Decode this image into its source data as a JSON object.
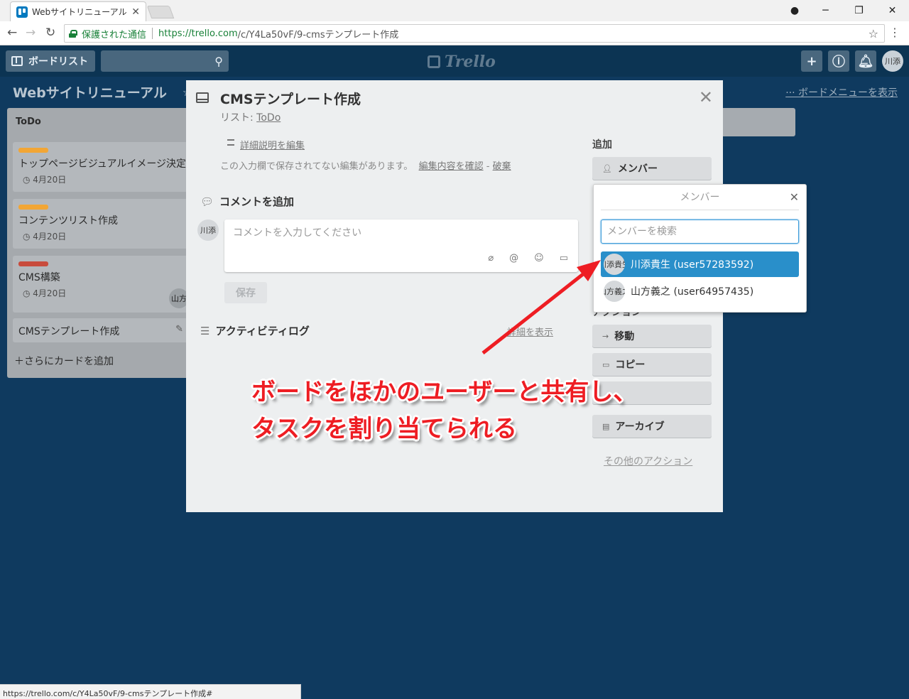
{
  "browser": {
    "tab_title": "Webサイトリニューアルのカ",
    "address_secure": "保護された通信",
    "url_scheme_host": "https://trello.com",
    "url_rest": "/c/Y4La50vF/9-cmsテンプレート作成",
    "status_url": "https://trello.com/c/Y4La50vF/9-cmsテンプレート作成#"
  },
  "header": {
    "board_list": "ボードリスト",
    "logo": "Trello",
    "avatar": "川添"
  },
  "board": {
    "title": "Webサイトリニューアル",
    "menu": "ボードメニューを表示",
    "list": {
      "name": "ToDo",
      "cards": [
        {
          "title": "トップページビジュアルイメージ決定",
          "due": "4月20日",
          "label_color": "#f2a635"
        },
        {
          "title": "コンテンツリスト作成",
          "due": "4月20日",
          "label_color": "#f2a635"
        },
        {
          "title": "CMS構築",
          "due": "4月20日",
          "label_color": "#c84b3c",
          "member": "山方"
        },
        {
          "title": "CMSテンプレート作成"
        }
      ],
      "add_card": "＋さらにカードを追加"
    }
  },
  "modal": {
    "title": "CMSテンプレート作成",
    "list_prefix": "リスト: ",
    "list_name": "ToDo",
    "edit_description": "詳細説明を編集",
    "unsaved_text": "この入力欄で保存されてない編集があります。",
    "unsaved_confirm": "編集内容を確認",
    "unsaved_sep": " - ",
    "unsaved_discard": "破棄",
    "comment_heading": "コメントを追加",
    "comment_avatar": "川添",
    "comment_placeholder": "コメントを入力してください",
    "save": "保存",
    "activity_heading": "アクティビティログ",
    "show_details": "詳細を表示",
    "side": {
      "add_heading": "追加",
      "member_button": "メンバー",
      "actions_heading": "アクション",
      "move": "移動",
      "copy": "コピー",
      "archive": "アーカイブ",
      "other_actions": "その他のアクション"
    }
  },
  "member_popover": {
    "title": "メンバー",
    "search_placeholder": "メンバーを検索",
    "members": [
      {
        "avatar": "川添貴生",
        "label": "川添貴生 (user57283592)"
      },
      {
        "avatar": "山方義之",
        "label": "山方義之 (user64957435)"
      }
    ]
  },
  "annotation": {
    "line1": "ボードをほかのユーザーと共有し、",
    "line2": "タスクを割り当てられる",
    "color": "#ee1d23"
  }
}
